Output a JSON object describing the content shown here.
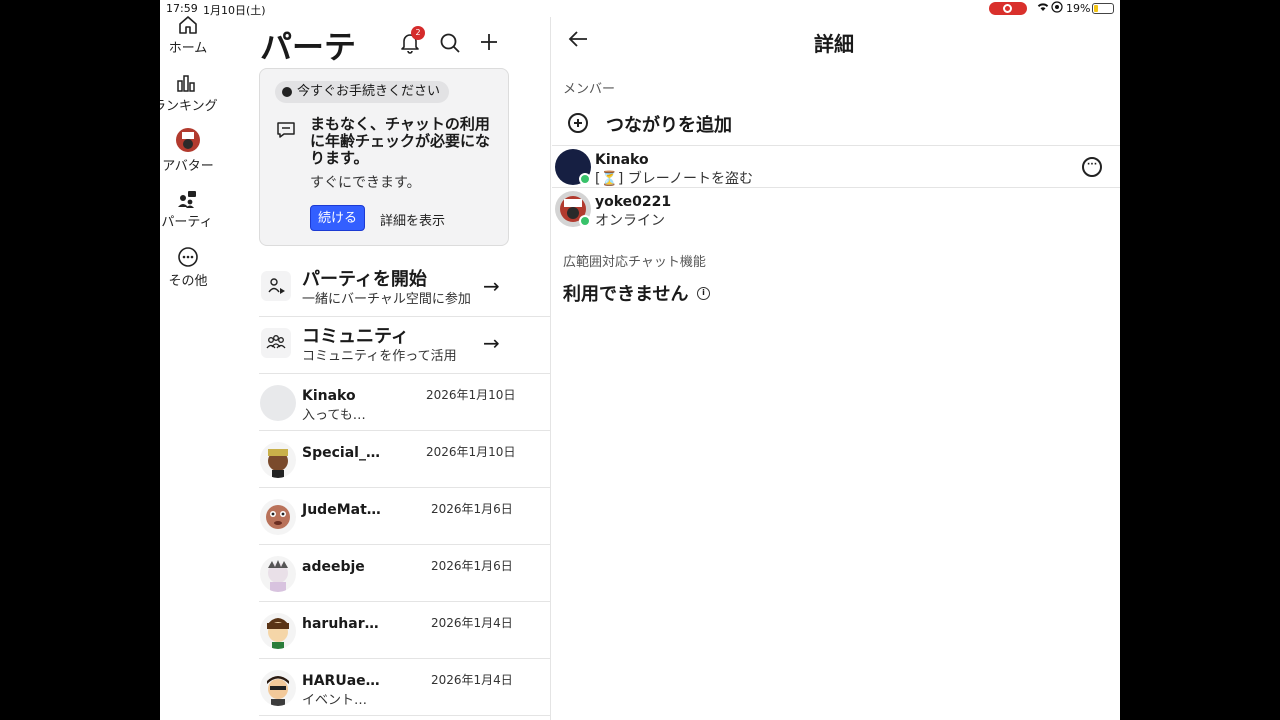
{
  "status_bar": {
    "time": "17:59",
    "date": "1月10日(土)",
    "battery": "19%"
  },
  "nav_rail": {
    "items": [
      {
        "label": "ホーム",
        "icon": "home-icon"
      },
      {
        "label": "ランキング",
        "icon": "chart-icon"
      },
      {
        "label": "アバター",
        "icon": "avatar-icon"
      },
      {
        "label": "パーティ",
        "icon": "party-icon"
      },
      {
        "label": "その他",
        "icon": "more-icon"
      }
    ]
  },
  "party": {
    "title": "パーテ",
    "notification_count": "2",
    "notice": {
      "pill": "今すぐお手続きください",
      "message": "まもなく、チャットの利用に年齢チェックが必要になります。",
      "sub": "すぐにできます。",
      "continue_label": "続ける",
      "details_label": "詳細を表示"
    },
    "actions": [
      {
        "title": "パーティを開始",
        "subtitle": "一緒にバーチャル空間に参加"
      },
      {
        "title": "コミュニティ",
        "subtitle": "コミュニティを作って活用"
      }
    ],
    "conversations": [
      {
        "name": "Kinako",
        "preview": "入っても…",
        "date": "2026年1月10日"
      },
      {
        "name": "Special_…",
        "preview": "",
        "date": "2026年1月10日"
      },
      {
        "name": "JudeMat…",
        "preview": "",
        "date": "2026年1月6日"
      },
      {
        "name": "adeebje",
        "preview": "",
        "date": "2026年1月6日"
      },
      {
        "name": "haruhar…",
        "preview": "",
        "date": "2026年1月4日"
      },
      {
        "name": "HARUae…",
        "preview": "イベント…",
        "date": "2026年1月4日"
      }
    ]
  },
  "detail": {
    "title": "詳細",
    "members_label": "メンバー",
    "add_connection": "つながりを追加",
    "members": [
      {
        "name": "Kinako",
        "status": "[⏳] ブレーノートを盗む"
      },
      {
        "name": "yoke0221",
        "status": "オンライン"
      }
    ],
    "chat_section_label": "広範囲対応チャット機能",
    "chat_unavailable": "利用できません"
  },
  "colors": {
    "accent_button": "#335fff",
    "badge": "#d52b2b",
    "online": "#38c26a"
  }
}
